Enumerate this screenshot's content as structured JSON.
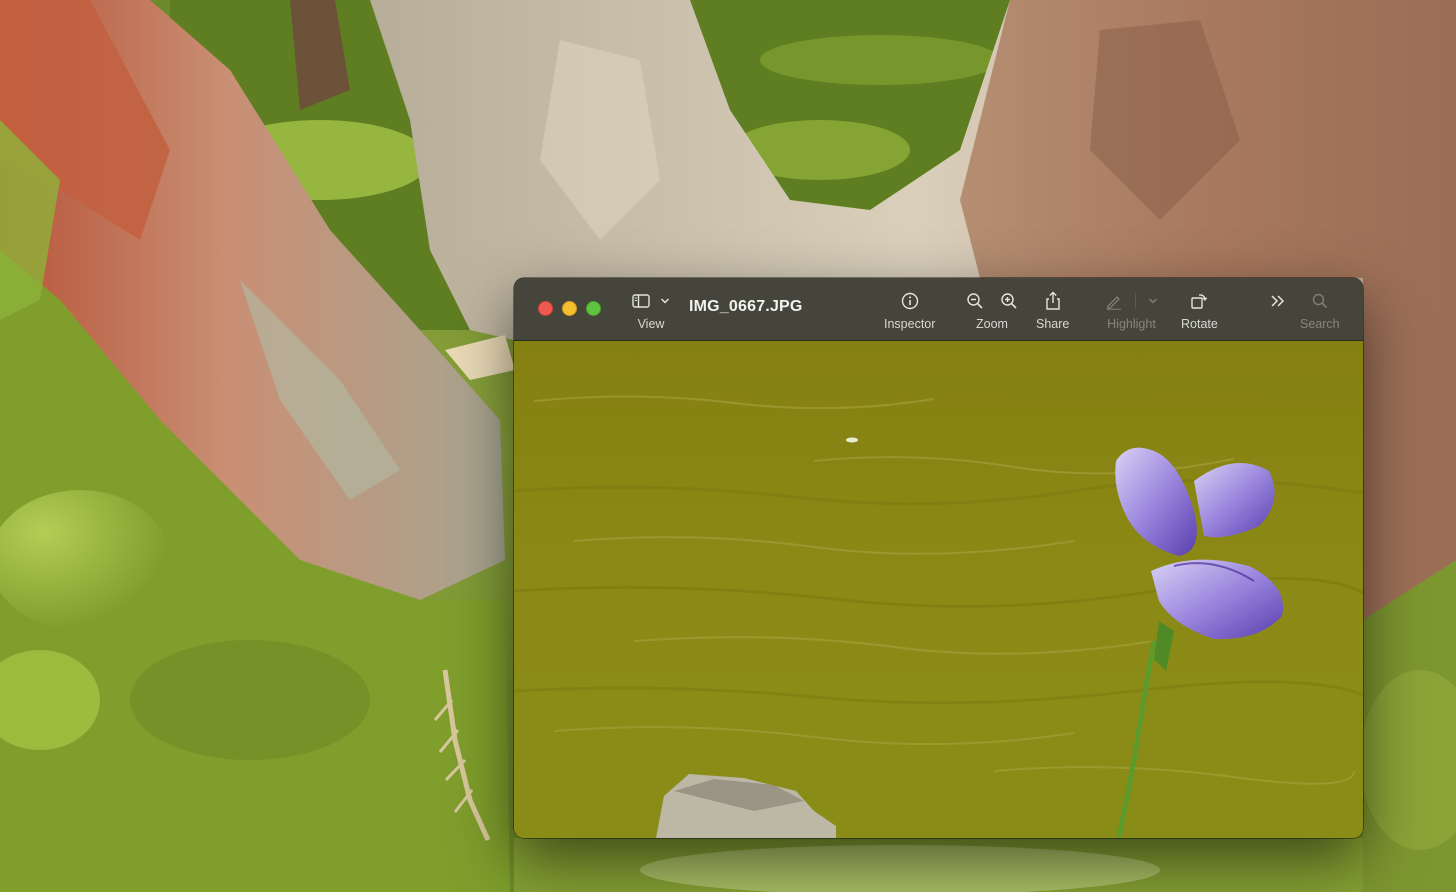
{
  "window": {
    "title": "IMG_0667.JPG"
  },
  "toolbar": {
    "view_label": "View",
    "inspector_label": "Inspector",
    "zoom_label": "Zoom",
    "share_label": "Share",
    "highlight_label": "Highlight",
    "rotate_label": "Rotate",
    "search_label": "Search"
  },
  "icons": {
    "view": "sidebar-icon",
    "view_menu": "chevron-down-icon",
    "inspector": "info-icon",
    "zoom_out": "zoom-out-icon",
    "zoom_in": "zoom-in-icon",
    "share": "share-icon",
    "highlight": "pen-icon",
    "highlight_menu": "chevron-down-icon",
    "rotate": "rotate-icon",
    "more": "double-chevron-right-icon",
    "search": "search-icon"
  },
  "colors": {
    "toolbar_bg": "#46453b",
    "close": "#ee5a52",
    "minimize": "#f5bd30",
    "zoom": "#5fc43e"
  },
  "photo": {
    "subject": "purple iris over green pond water"
  }
}
